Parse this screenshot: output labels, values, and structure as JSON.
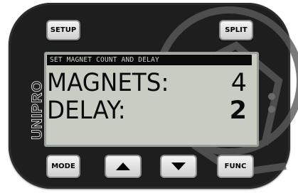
{
  "device": {
    "brand": "UNIPRO",
    "buttons": {
      "setup": "SETUP",
      "split": "SPLIT",
      "mode": "MODE",
      "func": "FUNC"
    },
    "icons": {
      "up": "up-triangle-icon",
      "down": "down-triangle-icon"
    }
  },
  "screen": {
    "header": "SET MAGNET COUNT AND DELAY",
    "rows": [
      {
        "label": "MAGNETS:",
        "value": "4"
      },
      {
        "label": "DELAY:",
        "value": "2"
      }
    ]
  },
  "colors": {
    "body": "#1e1e1e",
    "lcd": "#c9ccc3",
    "strip": "#0b0b0b",
    "button": "#e6e6e6"
  }
}
